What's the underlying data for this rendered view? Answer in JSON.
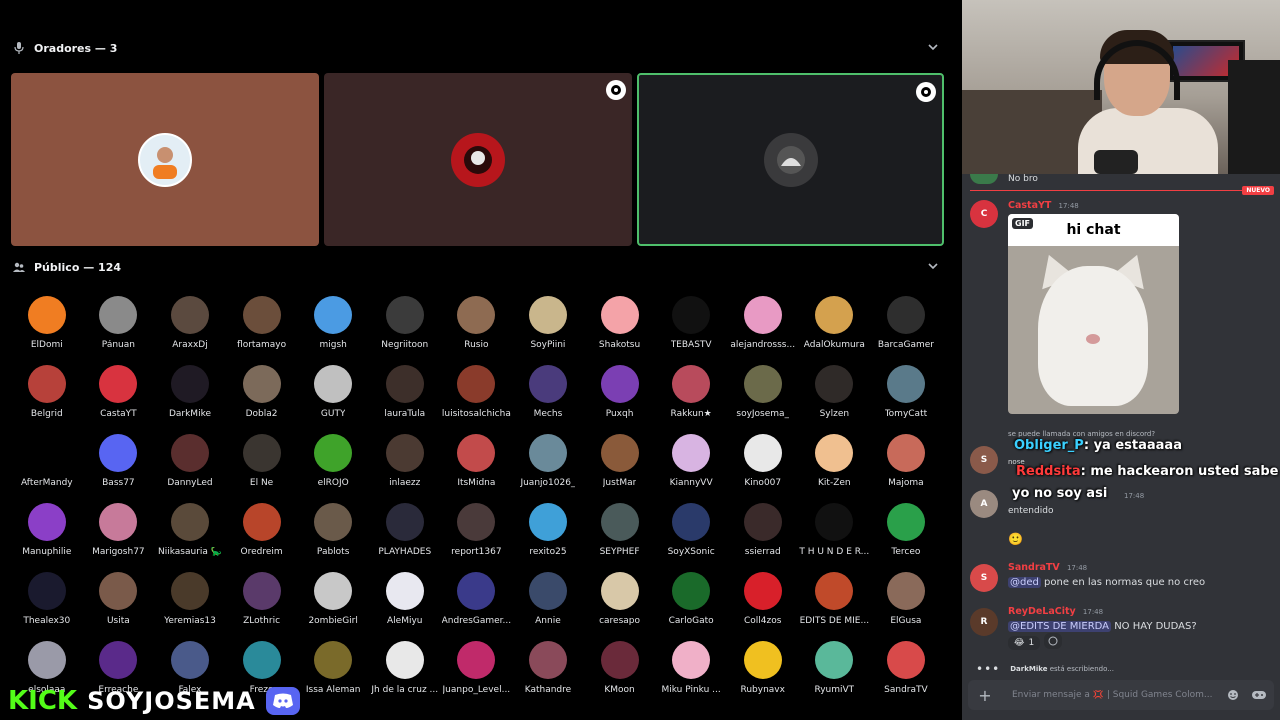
{
  "stage": {
    "speakers_header": "Oradores — 3",
    "public_header": "Público — 124",
    "speakers": [
      {
        "initial": "",
        "color": "#e3eef5"
      },
      {
        "initial": "",
        "color": "#b7161c"
      },
      {
        "initial": "",
        "color": "#3a3a3c"
      }
    ],
    "members": [
      {
        "name": "ElDomi",
        "color": "#f07d22"
      },
      {
        "name": "Pánuan",
        "color": "#8a8a8a"
      },
      {
        "name": "AraxxDj",
        "color": "#5b4a3f"
      },
      {
        "name": "flortamayo",
        "color": "#6b4e3b"
      },
      {
        "name": "migsh",
        "color": "#4b9be3"
      },
      {
        "name": "Negriitoon",
        "color": "#3b3b3b"
      },
      {
        "name": "Rusio",
        "color": "#8e6b52"
      },
      {
        "name": "SoyPiini",
        "color": "#c9b68c"
      },
      {
        "name": "Shakotsu",
        "color": "#f4a3a8"
      },
      {
        "name": "TEBASTV",
        "color": "#111111"
      },
      {
        "name": "alejandrosss...",
        "color": "#e89ac4"
      },
      {
        "name": "AdalOkumura",
        "color": "#d4a14e"
      },
      {
        "name": "BarcaGamer",
        "color": "#2e2e2e"
      },
      {
        "name": "Belgrid",
        "color": "#b7413a"
      },
      {
        "name": "CastaYT",
        "color": "#d8333f"
      },
      {
        "name": "DarkMike",
        "color": "#1f1a24"
      },
      {
        "name": "Dobla2",
        "color": "#7c6a5a"
      },
      {
        "name": "GUTY",
        "color": "#c0c0c0"
      },
      {
        "name": "lauraTula",
        "color": "#3d2f2a"
      },
      {
        "name": "luisitosalchicha",
        "color": "#8a3b2b"
      },
      {
        "name": "Mechs",
        "color": "#4a3b7c"
      },
      {
        "name": "Puxqh",
        "color": "#7b3fb3"
      },
      {
        "name": "Rakkun★",
        "color": "#b84b5c"
      },
      {
        "name": "soyJosema_",
        "color": "#6b6a4a"
      },
      {
        "name": "Sylzen",
        "color": "#2f2a28"
      },
      {
        "name": "TomyCatt",
        "color": "#5a7a8a"
      },
      {
        "name": "AfterMandy",
        "color": "#000000"
      },
      {
        "name": "Bass77",
        "color": "#5865f2"
      },
      {
        "name": "DannyLed",
        "color": "#5a2e2e"
      },
      {
        "name": "El Ñe",
        "color": "#3a3530"
      },
      {
        "name": "elROJO",
        "color": "#3fa32a"
      },
      {
        "name": "inlaezz",
        "color": "#4b3a32"
      },
      {
        "name": "ItsMidna",
        "color": "#c24b4b"
      },
      {
        "name": "Juanjo1026_",
        "color": "#6a8a9a"
      },
      {
        "name": "JustMar",
        "color": "#8a5a3a"
      },
      {
        "name": "KiannyVV",
        "color": "#d8b4e2"
      },
      {
        "name": "Kino007",
        "color": "#e8e8e8"
      },
      {
        "name": "Kit-Zen",
        "color": "#f0c090"
      },
      {
        "name": "Majoma",
        "color": "#c86a5a"
      },
      {
        "name": "Manuphilie",
        "color": "#8b3fc7"
      },
      {
        "name": "Marigosh77",
        "color": "#c77a9a"
      },
      {
        "name": "Niikasauria 🦕",
        "color": "#5a4a3a"
      },
      {
        "name": "Oredreim",
        "color": "#b8452a"
      },
      {
        "name": "Pablots",
        "color": "#6a5a4a"
      },
      {
        "name": "PLAYHADES",
        "color": "#2a2a3a"
      },
      {
        "name": "report1367",
        "color": "#4a3a3a"
      },
      {
        "name": "rexito25",
        "color": "#3fa0d8"
      },
      {
        "name": "SEYPHEF",
        "color": "#4a5a5a"
      },
      {
        "name": "SoyXSonic",
        "color": "#2a3a6a"
      },
      {
        "name": "ssierrad",
        "color": "#3a2a2a"
      },
      {
        "name": "T H U N D E R...",
        "color": "#111111"
      },
      {
        "name": "Terceo",
        "color": "#2aa04a"
      },
      {
        "name": "Thealex30",
        "color": "#1a1a2e"
      },
      {
        "name": "Usita",
        "color": "#7a5a4a"
      },
      {
        "name": "Yeremias13",
        "color": "#4a3a2a"
      },
      {
        "name": "ZLothric",
        "color": "#5a3a6a"
      },
      {
        "name": "2ombieGirl",
        "color": "#c8c8c8"
      },
      {
        "name": "AleMiyu",
        "color": "#e8e8f0"
      },
      {
        "name": "AndresGamer...",
        "color": "#3a3a8a"
      },
      {
        "name": "Annie",
        "color": "#3a4a6a"
      },
      {
        "name": "caresapo",
        "color": "#d8c8a8"
      },
      {
        "name": "CarloGato",
        "color": "#1a6a2a"
      },
      {
        "name": "Coll4zos",
        "color": "#d8202a"
      },
      {
        "name": "EDITS DE MIE...",
        "color": "#c04a2a"
      },
      {
        "name": "ElGusa",
        "color": "#8a6a5a"
      },
      {
        "name": "elsolaaa",
        "color": "#9a9aa8"
      },
      {
        "name": "Erreache",
        "color": "#5a2a8a"
      },
      {
        "name": "Falex",
        "color": "#4a5a8a"
      },
      {
        "name": "Frezo",
        "color": "#2a8a9a"
      },
      {
        "name": "Issa Aleman",
        "color": "#7a6a2a"
      },
      {
        "name": "Jh de la cruz ...",
        "color": "#e8e8e8"
      },
      {
        "name": "Juanpo_Level...",
        "color": "#c02a6a"
      },
      {
        "name": "Kathandre",
        "color": "#8a4a5a"
      },
      {
        "name": "KMoon",
        "color": "#6a2a3a"
      },
      {
        "name": "Miku Pinku ...",
        "color": "#f0b0c8"
      },
      {
        "name": "Rubynavx",
        "color": "#f0c020"
      },
      {
        "name": "RyumiVT",
        "color": "#5ab89a"
      },
      {
        "name": "SandraTV",
        "color": "#d84a4a"
      }
    ]
  },
  "overlay": {
    "brand_left": "KICK",
    "brand_handle": "SOYJOSEMA"
  },
  "chat": {
    "top_message": "No bro",
    "new_label": "NUEVO",
    "gif_label": "GIF",
    "gif_caption": "hi chat",
    "messages": [
      {
        "user": "CastaYT",
        "time": "17:48",
        "color": "#f23f43",
        "avatar_color": "#d8333f"
      },
      {
        "reply_text": "se puede llamada con amigos en discord?",
        "text_prefix": "nose"
      },
      {
        "text": "entendido",
        "time": "17:48"
      },
      {
        "user": "SandraTV",
        "time": "17:48",
        "mention": "@ded",
        "text": "pone en las normas que no creo",
        "color": "#f23f43"
      },
      {
        "user": "ReyDeLaCity",
        "time": "17:48",
        "mention": "@EDITS DE MIERDA",
        "text": "NO HAY DUDAS?",
        "color": "#f23f43",
        "reaction_count": "1"
      }
    ],
    "overlay_lines": [
      {
        "user": "Obliger_P",
        "text": ": ya estaaaaa",
        "color": "#3ad0ff"
      },
      {
        "user": "Reddsita",
        "text": ": me hackearon usted sabe que",
        "color": "#ff3b3b"
      },
      {
        "user": "",
        "text": "yo no soy asi",
        "color": "#ffffff"
      }
    ],
    "typing_user": "DarkMike",
    "typing_text": "está escribiendo...",
    "composer_placeholder": "Enviar mensaje a 💢 | Squid Games Colom..."
  }
}
